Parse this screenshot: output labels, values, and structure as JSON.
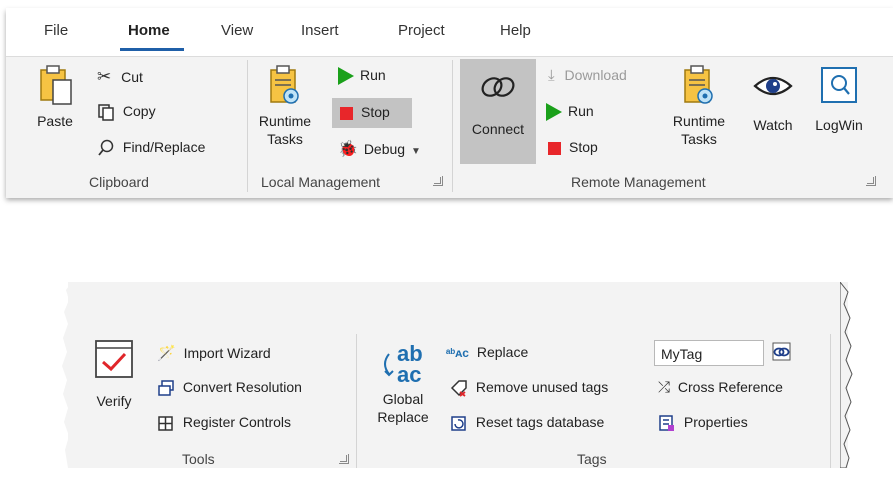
{
  "ribbon_top": {
    "tabs": [
      "File",
      "Home",
      "View",
      "Insert",
      "Project",
      "Help"
    ],
    "active_tab": "Home",
    "clipboard": {
      "paste": "Paste",
      "cut": "Cut",
      "copy": "Copy",
      "find_replace": "Find/Replace",
      "group_label": "Clipboard"
    },
    "local_management": {
      "runtime_tasks_line1": "Runtime",
      "runtime_tasks_line2": "Tasks",
      "run": "Run",
      "stop": "Stop",
      "debug": "Debug",
      "group_label": "Local Management"
    },
    "remote_management": {
      "connect": "Connect",
      "download": "Download",
      "run": "Run",
      "stop": "Stop",
      "runtime_tasks_line1": "Runtime",
      "runtime_tasks_line2": "Tasks",
      "watch": "Watch",
      "logwin": "LogWin",
      "group_label": "Remote Management"
    }
  },
  "ribbon_bottom": {
    "tools": {
      "verify": "Verify",
      "import_wizard": "Import Wizard",
      "convert_resolution": "Convert Resolution",
      "register_controls": "Register Controls",
      "group_label": "Tools"
    },
    "tags": {
      "global_replace_line1": "Global",
      "global_replace_line2": "Replace",
      "replace": "Replace",
      "remove_unused_tags": "Remove unused tags",
      "reset_tags_database": "Reset tags database",
      "tag_input_value": "MyTag",
      "cross_reference": "Cross Reference",
      "properties": "Properties",
      "group_label": "Tags"
    }
  },
  "colors": {
    "accent": "#1f5fa8",
    "ribbon_bg": "#f3f3f3",
    "highlight": "#c3c3c3",
    "run_green": "#1aa01a",
    "stop_red": "#e8262a"
  }
}
